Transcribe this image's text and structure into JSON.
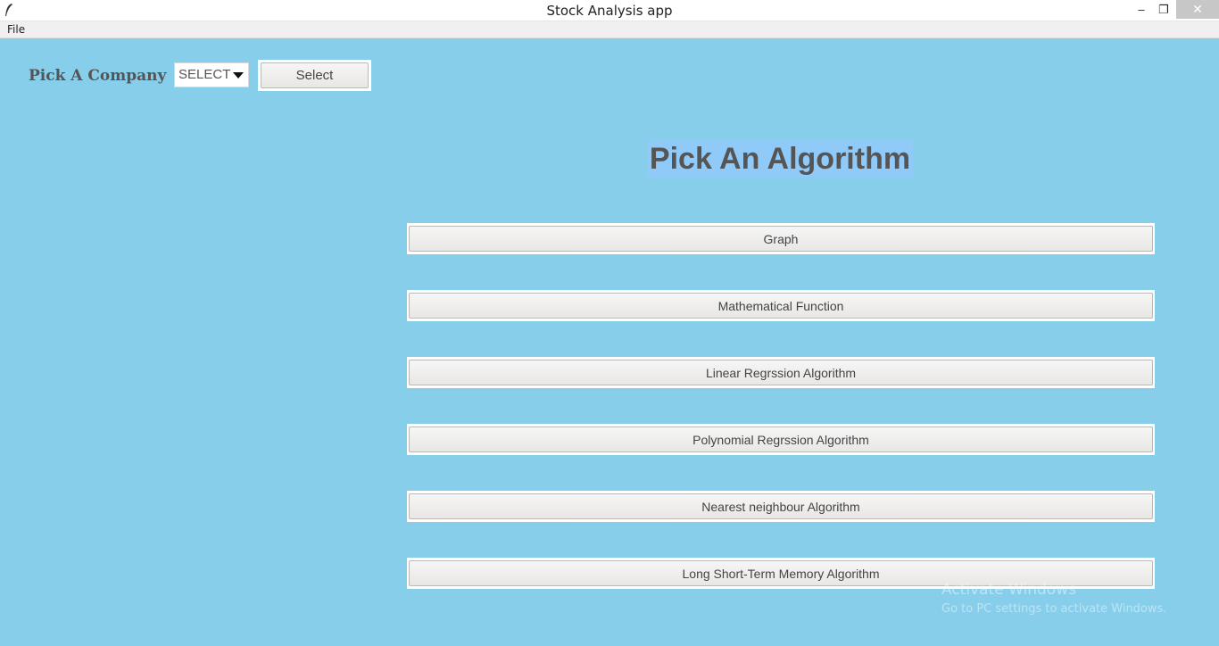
{
  "window": {
    "title": "Stock Analysis  app",
    "minimize_glyph": "–",
    "maximize_glyph": "❐",
    "close_glyph": "✕",
    "icon": "feather-icon"
  },
  "menubar": {
    "file_label": "File"
  },
  "company": {
    "label": "Pick A Company",
    "dropdown_value": "SELECT",
    "select_button": "Select"
  },
  "algorithms": {
    "heading": "Pick An Algorithm",
    "buttons": [
      "Graph",
      "Mathematical Function",
      "Linear Regrssion Algorithm",
      "Polynomial Regrssion Algorithm",
      "Nearest neighbour Algorithm",
      "Long Short-Term Memory Algorithm"
    ]
  },
  "watermark": {
    "line1": "Activate Windows",
    "line2": "Go to PC settings to activate Windows."
  },
  "colors": {
    "background": "#87ceeb",
    "heading_bg": "#90caf9"
  }
}
